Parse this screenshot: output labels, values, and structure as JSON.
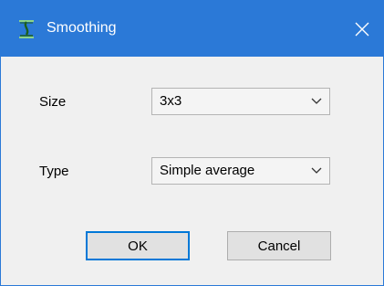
{
  "window": {
    "title": "Smoothing",
    "app_icon": "smoothing-app-icon",
    "close_icon": "close-icon"
  },
  "form": {
    "size": {
      "label": "Size",
      "selected": "3x3"
    },
    "type": {
      "label": "Type",
      "selected": "Simple average"
    }
  },
  "buttons": {
    "ok_label": "OK",
    "cancel_label": "Cancel"
  },
  "colors": {
    "titlebar": "#2b79d7",
    "default_button_border": "#0078d7",
    "dialog_background": "#f0f0f0"
  }
}
